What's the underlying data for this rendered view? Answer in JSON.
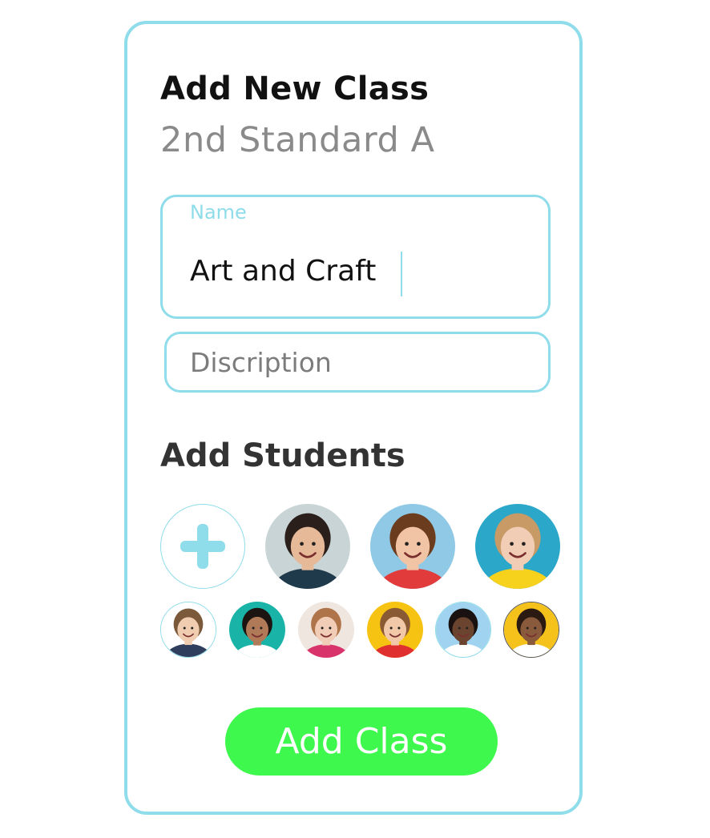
{
  "form": {
    "title": "Add New Class",
    "subtitle": "2nd Standard A",
    "name_field": {
      "label": "Name",
      "value": "Art and Craft"
    },
    "description_field": {
      "placeholder": "Discription"
    }
  },
  "students": {
    "section_title": "Add Students",
    "add_icon": "plus-icon",
    "photos_row1": [
      {
        "bg": "#c9d4d6",
        "skin": "#e6b999",
        "hair": "#2a1f1a",
        "shirt": "#1f3a4a"
      },
      {
        "bg": "#8fc9e6",
        "skin": "#f0c4a4",
        "hair": "#6b3d1e",
        "shirt": "#e23b3b"
      },
      {
        "bg": "#2aa7c9",
        "skin": "#f2cdb5",
        "hair": "#c79a66",
        "shirt": "#f6d21c"
      }
    ],
    "photos_row2": [
      {
        "bg": "#ffffff",
        "skin": "#f0ccb0",
        "hair": "#7a5a3a",
        "shirt": "#2f3e5c"
      },
      {
        "bg": "#1ab3a8",
        "skin": "#b07a58",
        "hair": "#1c1410",
        "shirt": "#ffffff"
      },
      {
        "bg": "#efe6e0",
        "skin": "#f1cdb8",
        "hair": "#b0744a",
        "shirt": "#d8336a"
      },
      {
        "bg": "#f6c312",
        "skin": "#f2c9a8",
        "hair": "#8a5a34",
        "shirt": "#e02f2f"
      },
      {
        "bg": "#9fd3ef",
        "skin": "#6b4430",
        "hair": "#1a1210",
        "shirt": "#ffffff"
      },
      {
        "bg": "#f4c21b",
        "skin": "#8a5a3c",
        "hair": "#2a1a12",
        "shirt": "#ffffff"
      }
    ]
  },
  "actions": {
    "submit_label": "Add Class"
  },
  "colors": {
    "accent": "#8fdcea",
    "button": "#3ff84e"
  }
}
